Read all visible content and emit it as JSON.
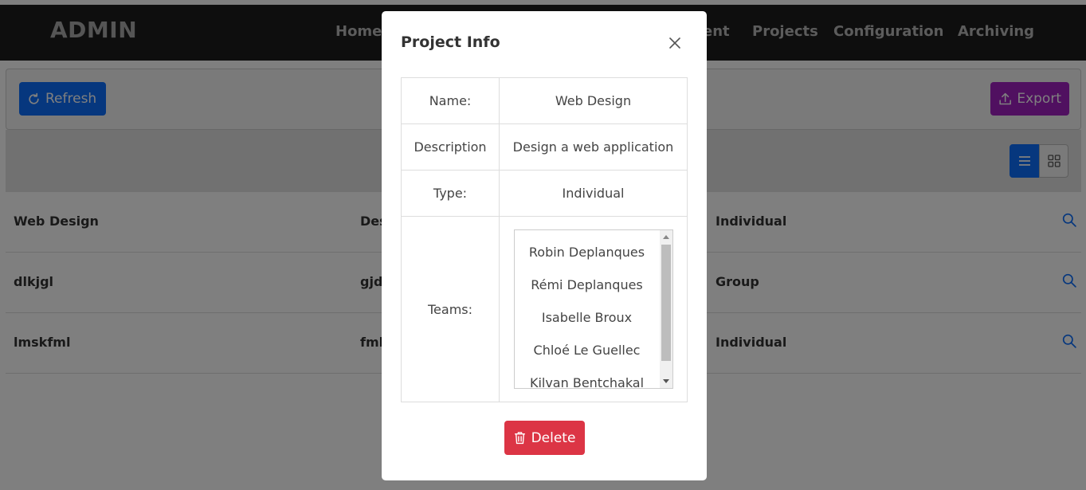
{
  "navbar": {
    "brand": "ADMIN",
    "links": [
      "Home",
      "ent",
      "Projects",
      "Configuration",
      "Archiving"
    ]
  },
  "toolbar": {
    "refresh_label": "Refresh",
    "export_label": "Export"
  },
  "rows": [
    {
      "name": "Web Design",
      "desc": "Des",
      "type": "Individual"
    },
    {
      "name": "dlkjgl",
      "desc": "gjd",
      "type": "Group"
    },
    {
      "name": "lmskfml",
      "desc": "fml",
      "type": "Individual"
    }
  ],
  "modal": {
    "title": "Project Info",
    "labels": {
      "name": "Name:",
      "description": "Description",
      "type": "Type:",
      "teams": "Teams:"
    },
    "values": {
      "name": "Web Design",
      "description": "Design a web application",
      "type": "Individual"
    },
    "teams": [
      "Robin Deplanques",
      "Rémi Deplanques",
      "Isabelle Broux",
      "Chloé Le Guellec",
      "Kilvan Bentchakal"
    ],
    "delete_label": "Delete"
  },
  "colors": {
    "primary": "#0d6efd",
    "export": "#a020c0",
    "danger": "#dc3545",
    "navbar": "#1c1c1c"
  }
}
